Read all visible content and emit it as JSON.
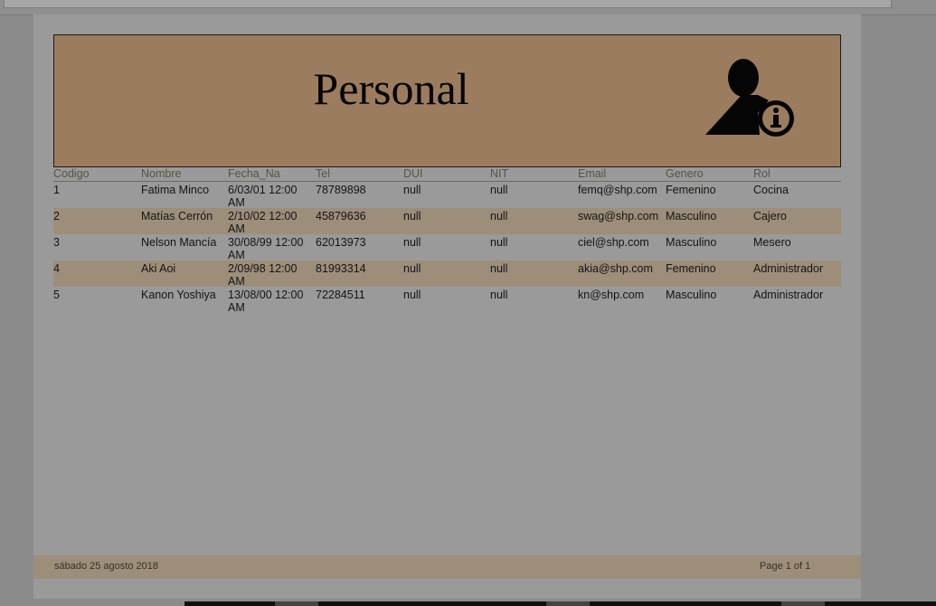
{
  "report": {
    "title": "Personal",
    "columns": [
      "Codigo",
      "Nombre",
      "Fecha_Na",
      "Tel",
      "DUI",
      "NIT",
      "Email",
      "Genero",
      "Rol"
    ],
    "rows": [
      [
        "1",
        "Fatima Minco",
        "6/03/01 12:00 AM",
        "78789898",
        "null",
        "null",
        "femq@shp.com",
        "Femenino",
        "Cocina"
      ],
      [
        "2",
        "Matías Cerrón",
        "2/10/02 12:00 AM",
        "45879636",
        "null",
        "null",
        "swag@shp.com",
        "Masculino",
        "Cajero"
      ],
      [
        "3",
        "Nelson Mancía",
        "30/08/99 12:00 AM",
        "62013973",
        "null",
        "null",
        "ciel@shp.com",
        "Masculino",
        "Mesero"
      ],
      [
        "4",
        "Aki Aoi",
        "2/09/98 12:00 AM",
        "81993314",
        "null",
        "null",
        "akia@shp.com",
        "Femenino",
        "Administrador"
      ],
      [
        "5",
        "Kanon Yoshiya",
        "13/08/00 12:00 AM",
        "72284511",
        "null",
        "null",
        "kn@shp.com",
        "Masculino",
        "Administrador"
      ]
    ]
  },
  "footer": {
    "date": "sábado 25 agosto 2018",
    "page": "Page 1 of 1"
  },
  "icons": {
    "header_icon": "user-info-icon"
  },
  "colors": {
    "banner": "#9c7c5e",
    "alt_row": "#9d8e7a"
  }
}
